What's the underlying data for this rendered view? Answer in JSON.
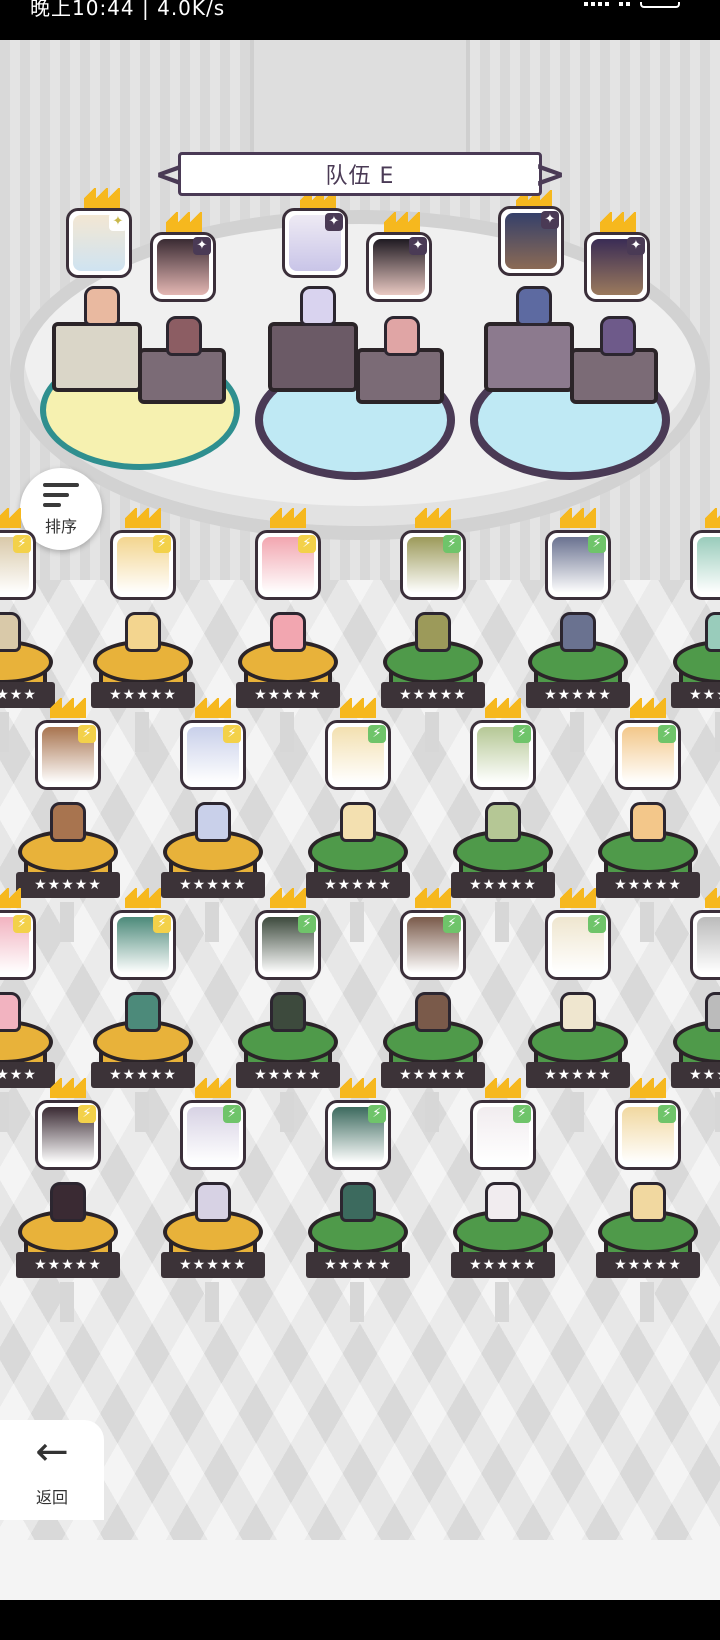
{
  "status_bar": {
    "text": "晚上10:44 | 4.0K/s"
  },
  "team_banner": {
    "title": "队伍 E",
    "prev": "<",
    "next": ">"
  },
  "sort_button": {
    "label": "排序",
    "icon": "sort-icon"
  },
  "back_button": {
    "label": "返回",
    "icon": "arrow-left-icon"
  },
  "stars": "★★★★★",
  "colors": {
    "gold": "#e8b23a",
    "green": "#4f9a4a",
    "slot_yellow": "#f6f1b0",
    "slot_blue": "#bfe9f4",
    "dark_outline": "#3b2f3a"
  }
}
